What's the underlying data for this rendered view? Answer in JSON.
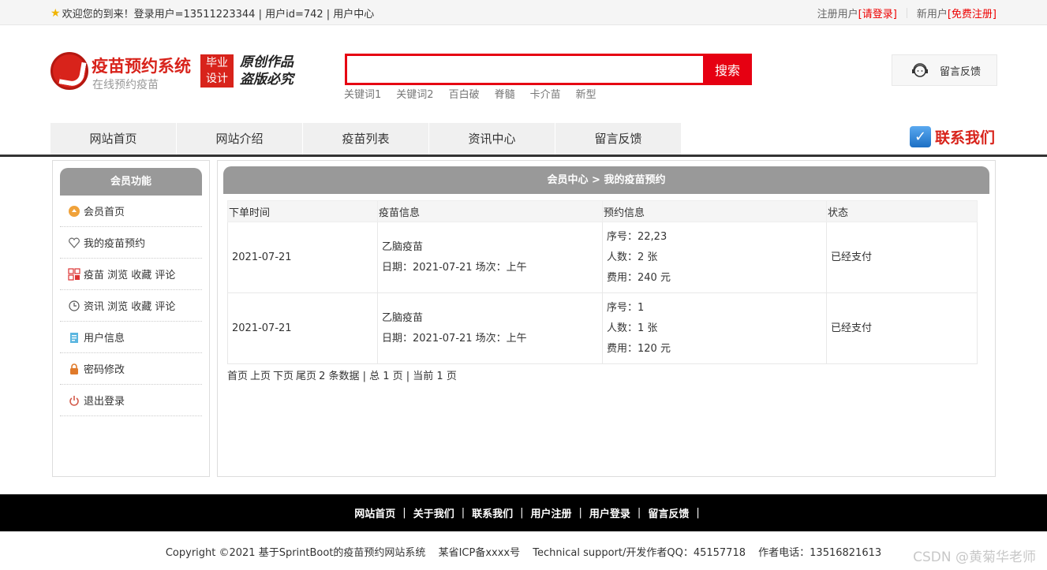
{
  "topbar": {
    "welcome": "欢迎您的到来！登录用户=13511223344 | 用户id=742 | 用户中心",
    "register_prefix": "注册用户",
    "login_link": "[请登录]",
    "new_user": "新用户",
    "signup_link": "[免费注册]"
  },
  "logo": {
    "title": "疫苗预约系统",
    "subtitle": "在线预约疫苗",
    "badge_line1": "毕业",
    "badge_line2": "设计",
    "slogan_line1": "原创作品",
    "slogan_line2": "盗版必究"
  },
  "search": {
    "value": "",
    "button": "搜索",
    "keywords": [
      "关键词1",
      "关键词2",
      "百白破",
      "脊髓",
      "卡介苗",
      "新型"
    ]
  },
  "feedback_box": {
    "label": "留言反馈"
  },
  "nav": {
    "items": [
      "网站首页",
      "网站介绍",
      "疫苗列表",
      "资讯中心",
      "留言反馈"
    ],
    "contact": "联系我们"
  },
  "side": {
    "title": "会员功能",
    "items": [
      {
        "label": "会员首页",
        "icon": "home-icon"
      },
      {
        "label": "我的疫苗预约",
        "icon": "heart-icon"
      },
      {
        "label": "疫苗 浏览 收藏 评论",
        "icon": "grid-icon"
      },
      {
        "label": "资讯 浏览 收藏 评论",
        "icon": "clock-icon"
      },
      {
        "label": "用户信息",
        "icon": "clipboard-icon"
      },
      {
        "label": "密码修改",
        "icon": "lock-icon"
      },
      {
        "label": "退出登录",
        "icon": "power-icon"
      }
    ]
  },
  "main": {
    "title": "会员中心 > 我的疫苗预约",
    "columns": [
      "下单时间",
      "疫苗信息",
      "预约信息",
      "状态"
    ],
    "rows": [
      {
        "time": "2021-07-21",
        "vaccine": "乙脑疫苗",
        "vaccine_detail": "日期：2021-07-21 场次：上午",
        "seq": "序号：22,23",
        "count": "人数：2 张",
        "fee": "费用：240 元",
        "status": "已经支付"
      },
      {
        "time": "2021-07-21",
        "vaccine": "乙脑疫苗",
        "vaccine_detail": "日期：2021-07-21 场次：上午",
        "seq": "序号：1",
        "count": "人数：1 张",
        "fee": "费用：120 元",
        "status": "已经支付"
      }
    ],
    "pager": {
      "first": "首页",
      "prev": "上页",
      "next": "下页",
      "last": "尾页",
      "summary": "2 条数据 | 总 1 页 | 当前 1 页"
    }
  },
  "footer": {
    "links": [
      "网站首页",
      "关于我们",
      "联系我们",
      "用户注册",
      "用户登录",
      "留言反馈"
    ],
    "separator": "|",
    "copyright": "Copyright ©2021 基于SprintBoot的疫苗预约网站系统",
    "icp": "某省ICP备xxxx号",
    "support": "Technical support/开发作者QQ：45157718",
    "phone": "作者电话：13516821613"
  },
  "watermark": "CSDN @黄菊华老师",
  "colors": {
    "accent": "#e60012",
    "panel_header": "#999999",
    "footer_bg": "#000000"
  }
}
